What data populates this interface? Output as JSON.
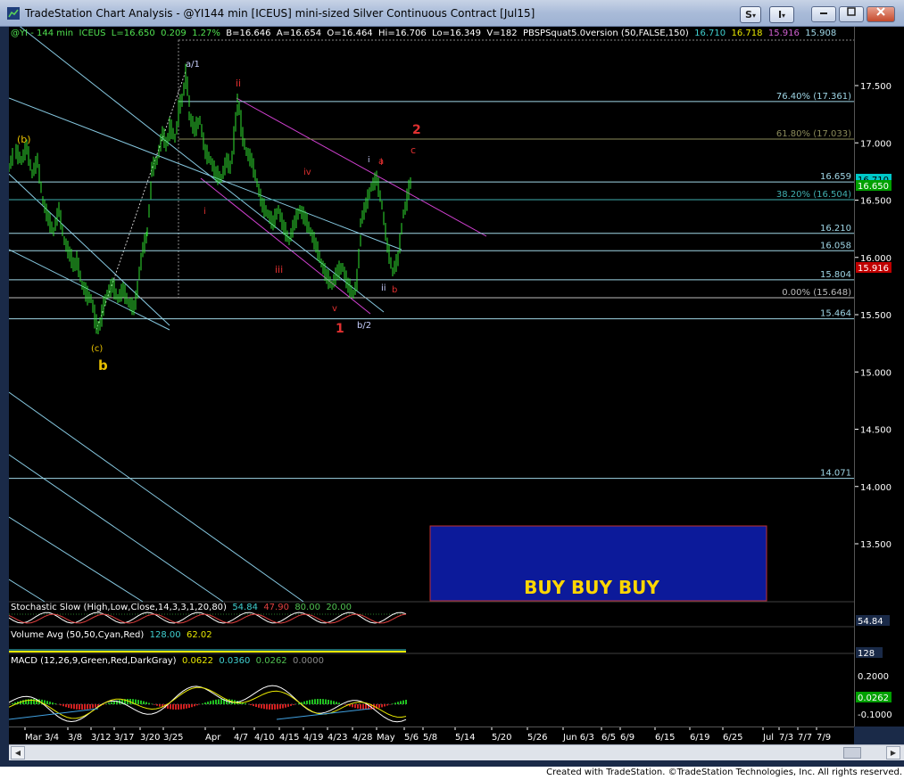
{
  "window": {
    "title": "TradeStation Chart Analysis - @YI144 min [ICEUS] mini-sized Silver Continuous Contract [Jul15]",
    "btn_s": "S",
    "btn_i": "I",
    "btn_dropdown": "▾"
  },
  "info_bar": {
    "symbol": "@YI - 144 min",
    "exchange": "ICEUS",
    "last": "L=16.650",
    "change": "0.209",
    "pct": "1.27%",
    "bid": "B=16.646",
    "ask": "A=16.654",
    "open": "O=16.464",
    "high": "Hi=16.706",
    "low": "Lo=16.349",
    "volume": "V=182",
    "study": "PBSPSquat5.0version (50,FALSE,150)",
    "v1": "16.710",
    "v2": "16.718",
    "v3": "15.916",
    "v4": "15.908"
  },
  "price_axis": {
    "ticks": [
      "17.500",
      "17.000",
      "16.500",
      "16.000",
      "15.500",
      "15.000",
      "14.500",
      "14.000",
      "13.500"
    ],
    "markers": [
      {
        "label": "16.710",
        "bg": "#00c8c8",
        "fg": "#000000"
      },
      {
        "label": "16.650",
        "bg": "#00a000",
        "fg": "#ffffff"
      },
      {
        "label": "15.916",
        "bg": "#c00000",
        "fg": "#ffffff"
      }
    ]
  },
  "levels": [
    {
      "label": "76.40% (17.361)",
      "price": 17.361,
      "color": "#9fd6e6"
    },
    {
      "label": "61.80% (17.033)",
      "price": 17.033,
      "color": "#8b8b5a"
    },
    {
      "label": "16.659",
      "price": 16.659,
      "color": "#9fd6e6"
    },
    {
      "label": "38.20% (16.504)",
      "price": 16.504,
      "color": "#40b0b0"
    },
    {
      "label": "16.210",
      "price": 16.21,
      "color": "#9fd6e6"
    },
    {
      "label": "16.058",
      "price": 16.058,
      "color": "#9fd6e6"
    },
    {
      "label": "15.804",
      "price": 15.804,
      "color": "#9fd6e6"
    },
    {
      "label": "0.00% (15.648)",
      "price": 15.648,
      "color": "#bbbbbb"
    },
    {
      "label": "15.464",
      "price": 15.464,
      "color": "#9fd6e6"
    },
    {
      "label": "14.071",
      "price": 14.071,
      "color": "#9fd6e6"
    }
  ],
  "wave_labels": [
    {
      "text": "(b)",
      "color": "#e8c000"
    },
    {
      "text": "a/1",
      "color": "#c8d0ff"
    },
    {
      "text": "ii",
      "color": "#e03030"
    },
    {
      "text": "2",
      "color": "#e03030"
    },
    {
      "text": "c",
      "color": "#e03030"
    },
    {
      "text": "iv",
      "color": "#e03030"
    },
    {
      "text": "i",
      "color": "#e03030"
    },
    {
      "text": "a",
      "color": "#e03030"
    },
    {
      "text": "i",
      "color": "#c8d0ff"
    },
    {
      "text": "i",
      "color": "#e03030"
    },
    {
      "text": "iii",
      "color": "#e03030"
    },
    {
      "text": "ii",
      "color": "#c8d0ff"
    },
    {
      "text": "b",
      "color": "#e03030"
    },
    {
      "text": "v",
      "color": "#e03030"
    },
    {
      "text": "1",
      "color": "#e03030"
    },
    {
      "text": "b/2",
      "color": "#c8d0ff"
    },
    {
      "text": "(c)",
      "color": "#e8c000"
    },
    {
      "text": "b",
      "color": "#e8c000"
    }
  ],
  "buy_box": {
    "text": "BUY BUY BUY"
  },
  "stochastic": {
    "label": "Stochastic Slow (High,Low,Close,14,3,3,1,20,80)",
    "values": [
      "54.84",
      "47.90",
      "80.00",
      "20.00"
    ],
    "axis_marker": "54.84"
  },
  "volume": {
    "label": "Volume Avg (50,50,Cyan,Red)",
    "values": [
      "128.00",
      "62.02"
    ],
    "axis_marker": "128"
  },
  "macd": {
    "label": "MACD (12,26,9,Green,Red,DarkGray)",
    "values": [
      "0.0622",
      "0.0360",
      "0.0262",
      "0.0000"
    ],
    "axis_ticks": [
      "0.2000",
      "0.0262",
      "-0.1000"
    ]
  },
  "time_axis": [
    "Mar 3/4",
    "3/8",
    "3/12",
    "3/17",
    "3/20",
    "3/25",
    "Apr",
    "4/7",
    "4/10",
    "4/15",
    "4/19",
    "4/23",
    "4/28",
    "May",
    "5/6",
    "5/8",
    "5/14",
    "5/20",
    "5/26",
    "Jun 6/3",
    "6/5",
    "6/9",
    "6/15",
    "6/19",
    "6/25",
    "Jul",
    "7/3",
    "7/7",
    "7/9"
  ],
  "footer": "Created with TradeStation. ©TradeStation Technologies, Inc. All rights reserved."
}
